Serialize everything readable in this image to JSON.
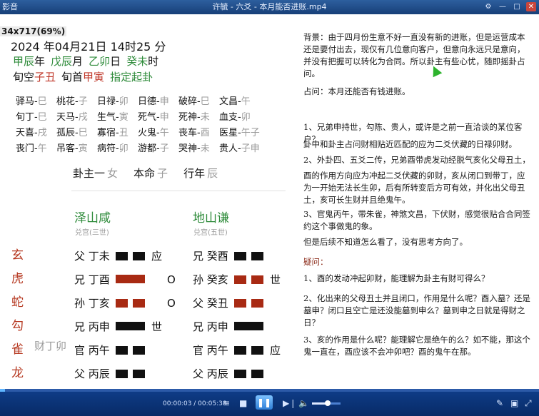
{
  "window": {
    "app_label": "影音",
    "title": "许毓 - 六爻 - 本月能否进账.mp4"
  },
  "overlay": {
    "resolution": "34x717(69%)"
  },
  "chart": {
    "datetime": "2024 年04月21日 14时25 分",
    "ganzhi": [
      {
        "gz": "甲辰",
        "unit": "年"
      },
      {
        "gz": "戊辰",
        "unit": "月"
      },
      {
        "gz": "乙卯",
        "unit": "日"
      },
      {
        "gz": "癸未",
        "unit": "时"
      }
    ],
    "xunkong_label": "旬空",
    "xunkong_value": "子丑",
    "xunshou_label": "旬首",
    "xunshou_value": "甲寅",
    "specify_link": "指定起卦",
    "shensha": [
      [
        {
          "n": "驿马-",
          "v": "巳"
        },
        {
          "n": "桃花-",
          "v": "子"
        },
        {
          "n": "日禄-",
          "v": "卯"
        },
        {
          "n": "日德-",
          "v": "申"
        },
        {
          "n": "破碎-",
          "v": "巳"
        },
        {
          "n": "文昌-",
          "v": "午"
        }
      ],
      [
        {
          "n": "旬丁-",
          "v": "巳"
        },
        {
          "n": "天马-",
          "v": "戌"
        },
        {
          "n": "生气-",
          "v": "寅"
        },
        {
          "n": "死气-",
          "v": "申"
        },
        {
          "n": "死神-",
          "v": "未"
        },
        {
          "n": "血支-",
          "v": "卯"
        }
      ],
      [
        {
          "n": "天喜-",
          "v": "戌"
        },
        {
          "n": "孤辰-",
          "v": "巳"
        },
        {
          "n": "寡宿-",
          "v": "丑"
        },
        {
          "n": "火鬼-",
          "v": "午"
        },
        {
          "n": "丧车-",
          "v": "酉"
        },
        {
          "n": "医星-",
          "v": "午子"
        }
      ],
      [
        {
          "n": "丧门-",
          "v": "午"
        },
        {
          "n": "吊客-",
          "v": "寅"
        },
        {
          "n": "病符-",
          "v": "卯"
        },
        {
          "n": "游都-",
          "v": "子"
        },
        {
          "n": "哭神-",
          "v": "未"
        },
        {
          "n": "贵人-",
          "v": "子申"
        }
      ]
    ],
    "guazhu": [
      {
        "n": "卦主一",
        "v": "女"
      },
      {
        "n": "本命",
        "v": "子"
      },
      {
        "n": "行年",
        "v": "辰"
      }
    ],
    "main_gua": {
      "name": "泽山咸",
      "palace": "兑宫(三世)"
    },
    "changed_gua": {
      "name": "地山谦",
      "palace": "兑宫(五世)"
    },
    "liushen": [
      "玄",
      "虎",
      "蛇",
      "勾",
      "雀",
      "龙"
    ],
    "fushen": "财丁卯",
    "main_lines": [
      {
        "label": "父 丁未",
        "type": "yin",
        "moving": false,
        "mark": "应"
      },
      {
        "label": "兄 丁酉",
        "type": "yang",
        "moving": true,
        "mark": "O"
      },
      {
        "label": "孙 丁亥",
        "type": "yin",
        "moving": true,
        "mark": "O"
      },
      {
        "label": "兄 丙申",
        "type": "yang",
        "moving": false,
        "mark": "世"
      },
      {
        "label": "官 丙午",
        "type": "yin",
        "moving": false,
        "mark": ""
      },
      {
        "label": "父 丙辰",
        "type": "yin",
        "moving": false,
        "mark": ""
      }
    ],
    "changed_lines": [
      {
        "label": "兄 癸酉",
        "type": "yin",
        "red": false,
        "mark": ""
      },
      {
        "label": "孙 癸亥",
        "type": "yin",
        "red": true,
        "mark": "世"
      },
      {
        "label": "父 癸丑",
        "type": "yin",
        "red": true,
        "mark": ""
      },
      {
        "label": "兄 丙申",
        "type": "yang",
        "red": false,
        "mark": ""
      },
      {
        "label": "官 丙午",
        "type": "yin",
        "red": false,
        "mark": "应"
      },
      {
        "label": "父 丙辰",
        "type": "yin",
        "red": false,
        "mark": ""
      }
    ]
  },
  "notes": {
    "background": "背景：由于四月份生意不好一直没有新的进账，但是运营成本还是要付出去，现仅有几位意向客户，但意向永远只是意向，并没有把握可以转化为合同。所以卦主有些心忧，随即摇卦占问。",
    "question": "占问：本月还能否有钱进账。",
    "p1": "1、兄弟申持世，勾陈、贵人，或许是之前一直洽谈的某位客户？",
    "p1b": "卦中和卦主占问财相贴近匹配的应为二爻伏藏的日禄卯财。",
    "p2": "2、外卦四、五爻二传，兄弟酉带虎发动经脱气亥化父母丑土，",
    "p2b": "酉的作用方向应为冲起二爻伏藏的卯财，亥从闭口到带丁，应为一开始无法长生卯，后有所转变后方可有效，并化出父母丑土，亥可长生财并且绝鬼午。",
    "p3": "3、官鬼丙午，带朱雀，神煞文昌，下伏财，感觉很贴合合同签约这个事做鬼的象。",
    "p3b": "但是后续不知道怎么看了，没有思考方向了。",
    "doubt_title": "疑问：",
    "d1": "1、酉的发动冲起卯财，能理解为卦主有财可得么？",
    "d2": "2、化出来的父母丑土并且闭口，作用是什么呢？酉入墓？还是墓申？闭口且空亡是还没能墓到申么？墓到申之日就是得财之日？",
    "d3": "3、亥的作用是什么呢？能理解它是绝午的么？如不能，那这个鬼一直在，酉应该不会冲卯吧？酉的鬼午在那。"
  },
  "player": {
    "time": "00:00:03 / 00:05:38",
    "progress": 0.009,
    "volume": 0.55
  }
}
